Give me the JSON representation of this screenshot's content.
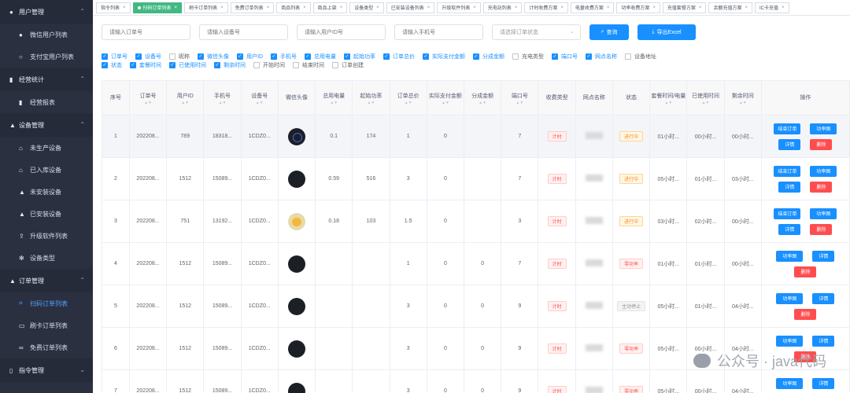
{
  "sidebar": {
    "groups": [
      {
        "label": "用户管理",
        "icon": "user-icon",
        "items": [
          {
            "label": "微信用户列表",
            "icon": "user-icon",
            "active": false
          },
          {
            "label": "支付宝用户列表",
            "icon": "user-outline-icon",
            "active": false
          }
        ]
      },
      {
        "label": "经营统计",
        "icon": "chart-icon",
        "items": [
          {
            "label": "经营报表",
            "icon": "chart-icon",
            "active": false
          }
        ]
      },
      {
        "label": "设备管理",
        "icon": "lock-icon",
        "items": [
          {
            "label": "未生产设备",
            "icon": "box-icon",
            "active": false
          },
          {
            "label": "已入库设备",
            "icon": "box-icon",
            "active": false
          },
          {
            "label": "未安装设备",
            "icon": "lock-icon",
            "active": false
          },
          {
            "label": "已安装设备",
            "icon": "lock-icon",
            "active": false
          },
          {
            "label": "升级软件列表",
            "icon": "upload-icon",
            "active": false
          },
          {
            "label": "设备类型",
            "icon": "gear-icon",
            "active": false
          }
        ]
      },
      {
        "label": "订单管理",
        "icon": "lock-icon",
        "items": [
          {
            "label": "扫码订单列表",
            "icon": "scan-icon",
            "active": true
          },
          {
            "label": "刷卡订单列表",
            "icon": "card-icon",
            "active": false
          },
          {
            "label": "免费订单列表",
            "icon": "link-icon",
            "active": false
          }
        ]
      },
      {
        "label": "指令管理",
        "icon": "doc-icon",
        "items": []
      }
    ]
  },
  "tabs": [
    {
      "label": "指令列表",
      "active": false
    },
    {
      "label": "扫码订单列表",
      "active": true
    },
    {
      "label": "刷卡订单列表",
      "active": false
    },
    {
      "label": "免费订单列表",
      "active": false
    },
    {
      "label": "商品列表",
      "active": false
    },
    {
      "label": "商品上架",
      "active": false
    },
    {
      "label": "设备类型",
      "active": false
    },
    {
      "label": "已安装设备列表",
      "active": false
    },
    {
      "label": "升级软件列表",
      "active": false
    },
    {
      "label": "充电站列表",
      "active": false
    },
    {
      "label": "计时收费方案",
      "active": false
    },
    {
      "label": "电量收费方案",
      "active": false
    },
    {
      "label": "功率收费方案",
      "active": false
    },
    {
      "label": "充值套餐方案",
      "active": false
    },
    {
      "label": "余额充值方案",
      "active": false
    },
    {
      "label": "IC卡充值",
      "active": false
    }
  ],
  "filters": {
    "order_no": "请输入订单号",
    "device_no": "请输入设备号",
    "user_id": "请输入用户ID号",
    "phone": "请输入手机号",
    "status_select": "请选择订单状态",
    "query_label": "查询",
    "export_label": "导出Excel"
  },
  "columns_toggle": [
    [
      {
        "label": "订单号",
        "checked": true
      },
      {
        "label": "设备号",
        "checked": true
      },
      {
        "label": "昵称",
        "checked": false
      },
      {
        "label": "微信头像",
        "checked": true
      },
      {
        "label": "用户ID",
        "checked": true
      },
      {
        "label": "手机号",
        "checked": true
      },
      {
        "label": "总用电量",
        "checked": true
      },
      {
        "label": "起始功率",
        "checked": true
      },
      {
        "label": "订单总价",
        "checked": true
      },
      {
        "label": "实际支付金额",
        "checked": true
      },
      {
        "label": "分成金额",
        "checked": true
      },
      {
        "label": "充电类型",
        "checked": false
      },
      {
        "label": "端口号",
        "checked": true
      },
      {
        "label": "网点名称",
        "checked": true
      },
      {
        "label": "设备地址",
        "checked": false
      }
    ],
    [
      {
        "label": "状态",
        "checked": true
      },
      {
        "label": "套餐时间",
        "checked": true
      },
      {
        "label": "已使用时间",
        "checked": true
      },
      {
        "label": "剩余时间",
        "checked": true
      },
      {
        "label": "开始时间",
        "checked": false
      },
      {
        "label": "结束时间",
        "checked": false
      },
      {
        "label": "订单创建",
        "checked": false
      }
    ]
  ],
  "table": {
    "headers": [
      "序号",
      "订单号",
      "用户ID",
      "手机号",
      "设备号",
      "微信头像",
      "总用电量",
      "起始功率",
      "订单总价",
      "实际支付金额",
      "分成金额",
      "端口号",
      "收费类型",
      "网点名称",
      "状态",
      "套餐时间/电量",
      "已使用时间",
      "剩余时间",
      "操作"
    ],
    "op_labels": {
      "end": "结束订单",
      "power": "功率图",
      "detail": "详情",
      "delete": "删除"
    },
    "rows": [
      {
        "idx": "1",
        "order": "202208...",
        "uid": "789",
        "phone": "18318...",
        "device": "1CDZ0...",
        "avatar": "b",
        "energy": "0.1",
        "power": "174",
        "total": "1",
        "paid": "0",
        "share": "",
        "port": "7",
        "charge": "计时",
        "status": "进行中",
        "status_tone": "t-orange",
        "plan": "01小时...",
        "used": "00小时...",
        "left": "00小时...",
        "end": true
      },
      {
        "idx": "2",
        "order": "202208...",
        "uid": "1512",
        "phone": "15089...",
        "device": "1CDZ0...",
        "avatar": "a",
        "energy": "0.59",
        "power": "516",
        "total": "3",
        "paid": "0",
        "share": "",
        "port": "7",
        "charge": "计时",
        "status": "进行中",
        "status_tone": "t-orange",
        "plan": "05小时...",
        "used": "01小时...",
        "left": "03小时...",
        "end": true
      },
      {
        "idx": "3",
        "order": "202208...",
        "uid": "751",
        "phone": "13192...",
        "device": "1CDZ0...",
        "avatar": "c",
        "energy": "0.18",
        "power": "103",
        "total": "1.5",
        "paid": "0",
        "share": "",
        "port": "3",
        "charge": "计时",
        "status": "进行中",
        "status_tone": "t-orange",
        "plan": "03小时...",
        "used": "02小时...",
        "left": "00小时...",
        "end": true
      },
      {
        "idx": "4",
        "order": "202208...",
        "uid": "1512",
        "phone": "15089...",
        "device": "1CDZ0...",
        "avatar": "a",
        "energy": "",
        "power": "",
        "total": "1",
        "paid": "0",
        "share": "0",
        "port": "7",
        "charge": "计时",
        "status": "零功率",
        "status_tone": "t-red",
        "plan": "01小时...",
        "used": "01小时...",
        "left": "00小时...",
        "end": false
      },
      {
        "idx": "5",
        "order": "202208...",
        "uid": "1512",
        "phone": "15089...",
        "device": "1CDZ0...",
        "avatar": "a",
        "energy": "",
        "power": "",
        "total": "3",
        "paid": "0",
        "share": "0",
        "port": "9",
        "charge": "计时",
        "status": "主动停止",
        "status_tone": "t-gray",
        "plan": "05小时...",
        "used": "01小时...",
        "left": "04小时...",
        "end": false
      },
      {
        "idx": "6",
        "order": "202208...",
        "uid": "1512",
        "phone": "15089...",
        "device": "1CDZ0...",
        "avatar": "a",
        "energy": "",
        "power": "",
        "total": "3",
        "paid": "0",
        "share": "0",
        "port": "9",
        "charge": "计时",
        "status": "零功率",
        "status_tone": "t-red",
        "plan": "05小时...",
        "used": "00小时...",
        "left": "04小时...",
        "end": false
      },
      {
        "idx": "7",
        "order": "202208...",
        "uid": "1512",
        "phone": "15089...",
        "device": "1CDZ0...",
        "avatar": "a",
        "energy": "",
        "power": "",
        "total": "3",
        "paid": "0",
        "share": "0",
        "port": "9",
        "charge": "计时",
        "status": "零功率",
        "status_tone": "t-red",
        "plan": "05小时...",
        "used": "00小时...",
        "left": "04小时...",
        "end": false
      }
    ]
  },
  "watermark": "公众号 · java代码"
}
